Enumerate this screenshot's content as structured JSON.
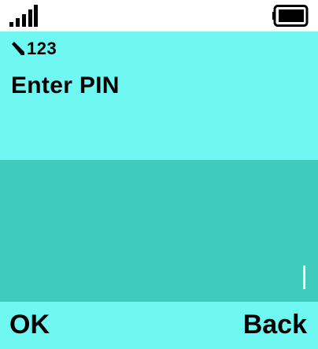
{
  "status_bar": {
    "signal_icon": "signal-bars-icon",
    "battery_icon": "battery-icon"
  },
  "input_mode": {
    "icon": "pencil-icon",
    "label": "123"
  },
  "dialog": {
    "title": "Enter PIN",
    "pin_value": ""
  },
  "softkeys": {
    "left": "OK",
    "right": "Back"
  },
  "colors": {
    "background": "#6ff7f1",
    "input_field": "#3ecbbc",
    "status_bar": "#ffffff",
    "text": "#000000"
  }
}
